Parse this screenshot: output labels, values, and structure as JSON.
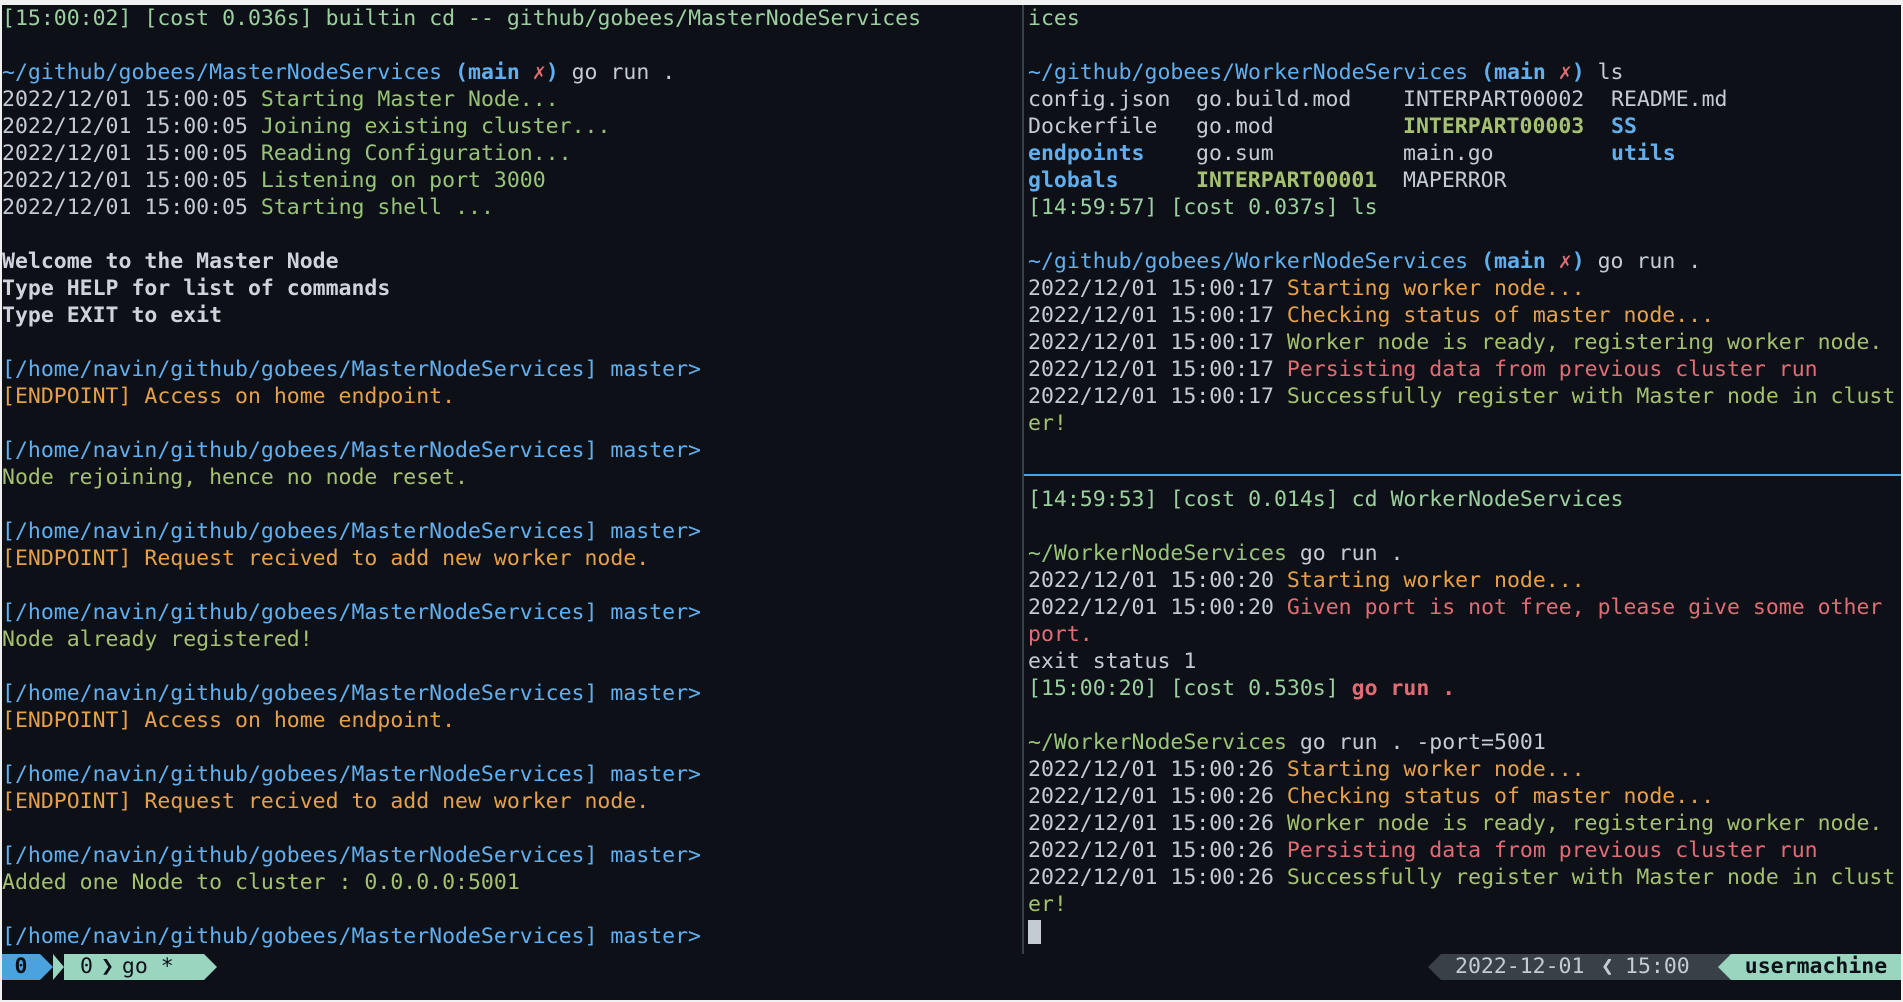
{
  "left_pane": {
    "header": {
      "time": "[15:00:02]",
      "cost": "[cost 0.036s]",
      "cmd": "builtin cd -- github/gobees/MasterNodeServices"
    },
    "prompt": {
      "path": "~/github/gobees/MasterNodeServices",
      "branch_open": "(",
      "branch": "main",
      "cross": "✗",
      "branch_close": ")",
      "cmd": "go run ."
    },
    "startup": [
      {
        "ts": "2022/12/01 15:00:05",
        "msg": "Starting Master Node..."
      },
      {
        "ts": "2022/12/01 15:00:05",
        "msg": "Joining existing cluster..."
      },
      {
        "ts": "2022/12/01 15:00:05",
        "msg": "Reading Configuration..."
      },
      {
        "ts": "2022/12/01 15:00:05",
        "msg": "Listening on port 3000"
      },
      {
        "ts": "2022/12/01 15:00:05",
        "msg": "Starting shell ..."
      }
    ],
    "welcome": [
      "Welcome to the Master Node",
      "Type HELP for list of commands",
      "Type EXIT to exit"
    ],
    "shell_prompt": "[/home/navin/github/gobees/MasterNodeServices]",
    "shell_user": "master>",
    "entries": [
      {
        "msg": "[ENDPOINT] Access on home endpoint."
      },
      {
        "msg": "Node rejoining, hence no node reset."
      },
      {
        "msg": "[ENDPOINT] Request recived to add new worker node."
      },
      {
        "msg": "Node already registered!"
      },
      {
        "msg": "[ENDPOINT] Access on home endpoint."
      },
      {
        "msg": "[ENDPOINT] Request recived to add new worker node."
      },
      {
        "msg": "Added one Node to cluster : 0.0.0.0:5001"
      }
    ]
  },
  "right_top_pane": {
    "overflow_line": "ices",
    "prompt1": {
      "path": "~/github/gobees/WorkerNodeServices",
      "branch_open": "(",
      "branch": "main",
      "cross": "✗",
      "branch_close": ")",
      "cmd": "ls"
    },
    "ls": [
      [
        "config.json",
        "go.build.mod",
        "INTERPART00002",
        "README.md"
      ],
      [
        "Dockerfile",
        "go.mod",
        "INTERPART00003",
        "SS"
      ],
      [
        "endpoints",
        "go.sum",
        "main.go",
        "utils"
      ],
      [
        "globals",
        "INTERPART00001",
        "MAPERROR",
        ""
      ]
    ],
    "ls_footer": {
      "time": "[14:59:57]",
      "cost": "[cost 0.037s]",
      "cmd": "ls"
    },
    "prompt2": {
      "path": "~/github/gobees/WorkerNodeServices",
      "branch_open": "(",
      "branch": "main",
      "cross": "✗",
      "branch_close": ")",
      "cmd": "go run ."
    },
    "logs": [
      {
        "ts": "2022/12/01 15:00:17",
        "msg": "Starting worker node..."
      },
      {
        "ts": "2022/12/01 15:00:17",
        "msg": "Checking status of master node..."
      },
      {
        "ts": "2022/12/01 15:00:17",
        "msg": "Worker node is ready, registering worker node."
      },
      {
        "ts": "2022/12/01 15:00:17",
        "msg": "Persisting data from previous cluster run"
      },
      {
        "ts": "2022/12/01 15:00:17",
        "msg": "Successfully register with Master node in clust"
      }
    ],
    "wrap": "er!"
  },
  "right_bottom_pane": {
    "header": {
      "time": "[14:59:53]",
      "cost": "[cost 0.014s]",
      "cmd": "cd WorkerNodeServices"
    },
    "prompt1": {
      "path": "~/WorkerNodeServices",
      "cmd": "go run ."
    },
    "run1": [
      {
        "ts": "2022/12/01 15:00:20",
        "msg": "Starting worker node..."
      },
      {
        "ts": "2022/12/01 15:00:20",
        "msg": "Given port is not free, please give some other"
      }
    ],
    "run1_wrap": "port.",
    "exit_status": "exit status 1",
    "run1_footer": {
      "time": "[15:00:20]",
      "cost": "[cost 0.530s]",
      "cmd": "go run ."
    },
    "prompt2": {
      "path": "~/WorkerNodeServices",
      "cmd": "go run . -port=5001"
    },
    "run2": [
      {
        "ts": "2022/12/01 15:00:26",
        "msg": "Starting worker node..."
      },
      {
        "ts": "2022/12/01 15:00:26",
        "msg": "Checking status of master node..."
      },
      {
        "ts": "2022/12/01 15:00:26",
        "msg": "Worker node is ready, registering worker node."
      },
      {
        "ts": "2022/12/01 15:00:26",
        "msg": "Persisting data from previous cluster run"
      },
      {
        "ts": "2022/12/01 15:00:26",
        "msg": "Successfully register with Master node in clust"
      }
    ],
    "run2_wrap": "er!"
  },
  "statusbar": {
    "session": "0",
    "window_index": "0",
    "window_name": "go *",
    "date": "2022-12-01",
    "time": "15:00",
    "host": "usermachine"
  }
}
